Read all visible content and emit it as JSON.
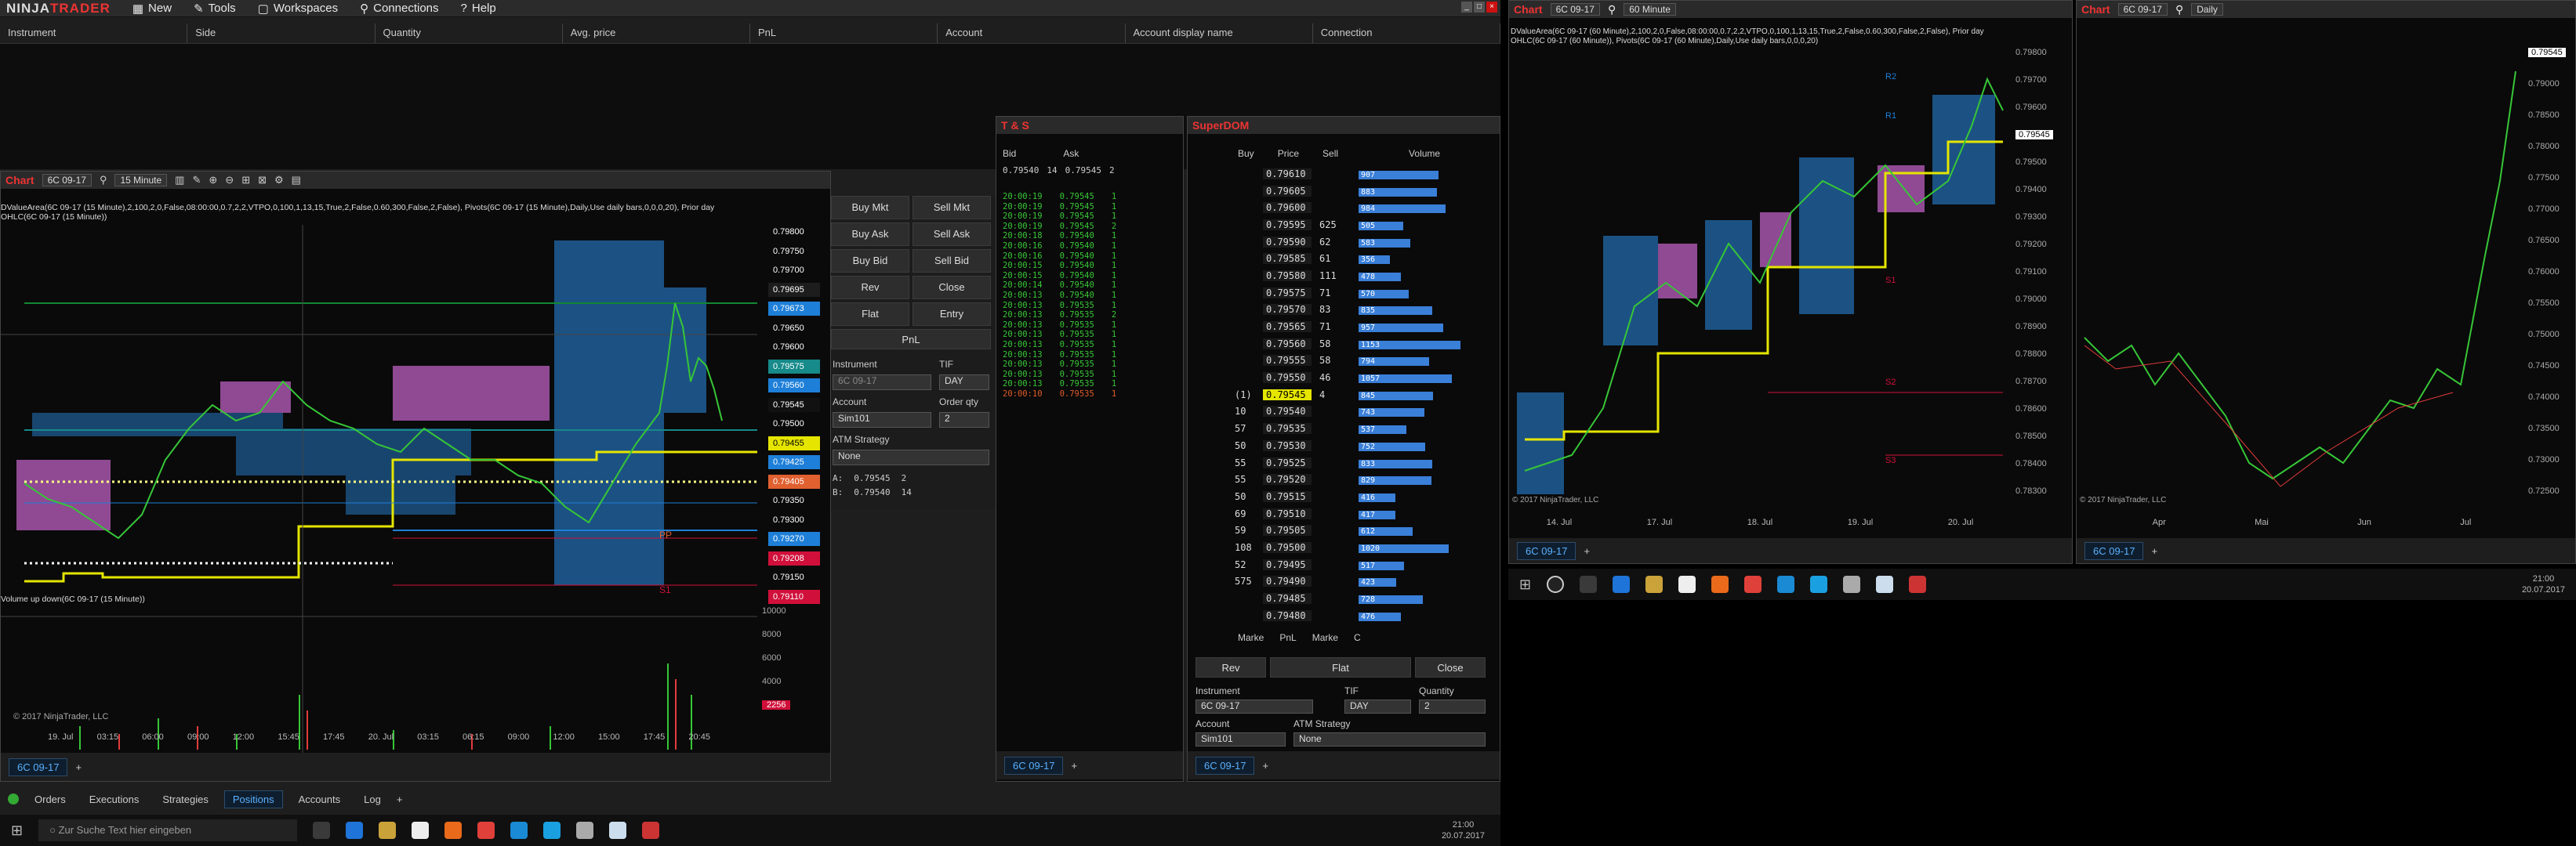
{
  "app": {
    "logo_a": "NINJA",
    "logo_b": "TRADER",
    "menu": [
      "New",
      "Tools",
      "Workspaces",
      "Connections",
      "Help"
    ]
  },
  "positions": {
    "columns": [
      "Instrument",
      "Side",
      "Quantity",
      "Avg. price",
      "PnL",
      "Account",
      "Account display name",
      "Connection"
    ]
  },
  "chart1": {
    "title": "Chart",
    "instrument": "6C 09-17",
    "interval": "15 Minute",
    "indicator_line1": "DValueArea(6C 09-17 (15 Minute),2,100,2,0,False,08:00:00,0.7,2,2,VTPO,0,100,1,13,15,True,2,False,0.60,300,False,2,False), Pivots(6C 09-17 (15 Minute),Daily,Use daily bars,0,0,0,20), Prior day",
    "indicator_line2": "OHLC(6C 09-17 (15 Minute))",
    "volume_label": "Volume up down(6C 09-17 (15 Minute))",
    "copyright": "© 2017 NinjaTrader, LLC",
    "price_labels": [
      {
        "v": "0.79800",
        "c": "#0a0a0a"
      },
      {
        "v": "0.79750",
        "c": "#0a0a0a"
      },
      {
        "v": "0.79700",
        "c": "#0a0a0a"
      },
      {
        "v": "0.79695",
        "c": "#1d1d1d"
      },
      {
        "v": "0.79673",
        "c": "#1e7fd8"
      },
      {
        "v": "0.79650",
        "c": "#0a0a0a"
      },
      {
        "v": "0.79600",
        "c": "#0a0a0a"
      },
      {
        "v": "0.79575",
        "c": "#178a8a"
      },
      {
        "v": "0.79560",
        "c": "#1e7fd8"
      },
      {
        "v": "0.79545",
        "c": "#111"
      },
      {
        "v": "0.79500",
        "c": "#0a0a0a"
      },
      {
        "v": "0.79455",
        "c": "#e5e500"
      },
      {
        "v": "0.79425",
        "c": "#1e7fd8"
      },
      {
        "v": "0.79405",
        "c": "#e06030"
      },
      {
        "v": "0.79350",
        "c": "#0a0a0a"
      },
      {
        "v": "0.79300",
        "c": "#0a0a0a"
      },
      {
        "v": "0.79270",
        "c": "#1e7fd8"
      },
      {
        "v": "0.79208",
        "c": "#d0103a"
      },
      {
        "v": "0.79150",
        "c": "#0a0a0a"
      },
      {
        "v": "0.79110",
        "c": "#d0103a"
      }
    ],
    "vol_axis": [
      "10000",
      "8000",
      "6000",
      "4000",
      "2256"
    ],
    "time_axis": [
      "19. Jul",
      "03:15",
      "06:00",
      "09:00",
      "12:00",
      "15:45",
      "17:45",
      "20. Jul",
      "03:15",
      "06:15",
      "09:00",
      "12:00",
      "15:00",
      "17:45",
      "20:45"
    ],
    "pivot_labels": [
      "PP",
      "S1"
    ],
    "tab": "6C 09-17"
  },
  "order_panel": {
    "buttons": [
      "Buy Mkt",
      "Sell Mkt",
      "Buy Ask",
      "Sell Ask",
      "Buy Bid",
      "Sell Bid",
      "Rev",
      "Close",
      "Flat",
      "Entry",
      "PnL"
    ],
    "instrument_label": "Instrument",
    "tif_label": "TIF",
    "instrument": "6C 09-17",
    "tif": "DAY",
    "account_label": "Account",
    "qty_label": "Order qty",
    "account": "Sim101",
    "qty": "2",
    "atm_label": "ATM Strategy",
    "atm": "None",
    "a_label": "A:",
    "a_price": "0.79545",
    "a_qty": "2",
    "b_label": "B:",
    "b_price": "0.79540",
    "b_qty": "14"
  },
  "ts": {
    "title": "T & S",
    "bid_header": "Bid",
    "ask_header": "Ask",
    "bid": "0.79540",
    "bid_size": "14",
    "ask": "0.79545",
    "ask_size": "2",
    "rows": [
      [
        "20:00:19",
        "0.79545",
        "1",
        "g"
      ],
      [
        "20:00:19",
        "0.79545",
        "1",
        "g"
      ],
      [
        "20:00:19",
        "0.79545",
        "1",
        "g"
      ],
      [
        "20:00:19",
        "0.79545",
        "2",
        "g"
      ],
      [
        "20:00:18",
        "0.79540",
        "1",
        "g"
      ],
      [
        "20:00:16",
        "0.79540",
        "1",
        "g"
      ],
      [
        "20:00:16",
        "0.79540",
        "1",
        "g"
      ],
      [
        "20:00:15",
        "0.79540",
        "1",
        "g"
      ],
      [
        "20:00:15",
        "0.79540",
        "1",
        "g"
      ],
      [
        "20:00:14",
        "0.79540",
        "1",
        "g"
      ],
      [
        "20:00:13",
        "0.79540",
        "1",
        "g"
      ],
      [
        "20:00:13",
        "0.79535",
        "1",
        "g"
      ],
      [
        "20:00:13",
        "0.79535",
        "2",
        "g"
      ],
      [
        "20:00:13",
        "0.79535",
        "1",
        "g"
      ],
      [
        "20:00:13",
        "0.79535",
        "1",
        "g"
      ],
      [
        "20:00:13",
        "0.79535",
        "1",
        "g"
      ],
      [
        "20:00:13",
        "0.79535",
        "1",
        "g"
      ],
      [
        "20:00:13",
        "0.79535",
        "1",
        "g"
      ],
      [
        "20:00:13",
        "0.79535",
        "1",
        "g"
      ],
      [
        "20:00:13",
        "0.79535",
        "1",
        "g"
      ],
      [
        "20:00:10",
        "0.79535",
        "1",
        "r"
      ]
    ],
    "tab": "6C 09-17"
  },
  "dom": {
    "title": "SuperDOM",
    "headers": [
      "Buy",
      "Price",
      "Sell",
      "Volume"
    ],
    "rows": [
      [
        "",
        "0.79610",
        "",
        "907"
      ],
      [
        "",
        "0.79605",
        "",
        "883"
      ],
      [
        "",
        "0.79600",
        "",
        "984"
      ],
      [
        "",
        "0.79595",
        "625",
        "505"
      ],
      [
        "",
        "0.79590",
        "62",
        "583"
      ],
      [
        "",
        "0.79585",
        "61",
        "356"
      ],
      [
        "",
        "0.79580",
        "111",
        "478"
      ],
      [
        "",
        "0.79575",
        "71",
        "570"
      ],
      [
        "",
        "0.79570",
        "83",
        "835"
      ],
      [
        "",
        "0.79565",
        "71",
        "957"
      ],
      [
        "",
        "0.79560",
        "58",
        "1153"
      ],
      [
        "",
        "0.79555",
        "58",
        "794"
      ],
      [
        "",
        "0.79550",
        "46",
        "1057"
      ],
      [
        "(1)",
        "0.79545",
        "4",
        "845"
      ],
      [
        "10",
        "0.79540",
        "",
        "743"
      ],
      [
        "57",
        "0.79535",
        "",
        "537"
      ],
      [
        "50",
        "0.79530",
        "",
        "752"
      ],
      [
        "55",
        "0.79525",
        "",
        "833"
      ],
      [
        "55",
        "0.79520",
        "",
        "829"
      ],
      [
        "50",
        "0.79515",
        "",
        "416"
      ],
      [
        "69",
        "0.79510",
        "",
        "417"
      ],
      [
        "59",
        "0.79505",
        "",
        "612"
      ],
      [
        "108",
        "0.79500",
        "",
        "1020"
      ],
      [
        "52",
        "0.79495",
        "",
        "517"
      ],
      [
        "575",
        "0.79490",
        "",
        "423"
      ],
      [
        "",
        "0.79485",
        "",
        "728"
      ],
      [
        "",
        "0.79480",
        "",
        "476"
      ]
    ],
    "bottom": [
      "Marke",
      "PnL",
      "Marke",
      "C"
    ],
    "buttons": [
      "Rev",
      "Flat",
      "Close"
    ],
    "instrument_label": "Instrument",
    "tif_label": "TIF",
    "qty_label": "Quantity",
    "instrument": "6C 09-17",
    "tif": "DAY",
    "qty": "2",
    "account_label": "Account",
    "atm_label": "ATM Strategy",
    "account": "Sim101",
    "atm": "None",
    "tab": "6C 09-17"
  },
  "chart2": {
    "title": "Chart",
    "instrument": "6C 09-17",
    "interval": "60 Minute",
    "indicator_line1": "DValueArea(6C 09-17 (60 Minute),2,100,2,0,False,08:00:00,0.7,2,2,VTPO,0,100,1,13,15,True,2,False,0.60,300,False,2,False), Prior day",
    "indicator_line2": "OHLC(6C 09-17 (60 Minute)), Pivots(6C 09-17 (60 Minute),Daily,Use daily bars,0,0,0,20)",
    "copyright": "© 2017 NinjaTrader, LLC",
    "price_axis": [
      "0.79800",
      "0.79700",
      "0.79600",
      "0.79545",
      "0.79500",
      "0.79400",
      "0.79300",
      "0.79200",
      "0.79100",
      "0.79000",
      "0.78900",
      "0.78800",
      "0.78700",
      "0.78600",
      "0.78500",
      "0.78400",
      "0.78300"
    ],
    "time_axis": [
      "14. Jul",
      "17. Jul",
      "18. Jul",
      "19. Jul",
      "20. Jul"
    ],
    "pivots": [
      "R2",
      "R1",
      "S1",
      "S2",
      "S3"
    ],
    "tab": "6C 09-17"
  },
  "chart3": {
    "title": "Chart",
    "instrument": "6C 09-17",
    "interval": "Daily",
    "copyright": "© 2017 NinjaTrader, LLC",
    "price_axis": [
      "0.79545",
      "0.79000",
      "0.78500",
      "0.78000",
      "0.77500",
      "0.77000",
      "0.76500",
      "0.76000",
      "0.75500",
      "0.75000",
      "0.74500",
      "0.74000",
      "0.73500",
      "0.73000",
      "0.72500"
    ],
    "time_axis": [
      "Apr",
      "Mai",
      "Jun",
      "Jul"
    ],
    "tab": "6C 09-17"
  },
  "bottom_tabs": [
    "Orders",
    "Executions",
    "Strategies",
    "Positions",
    "Accounts",
    "Log"
  ],
  "taskbar_left": {
    "search": "Zur Suche Text hier eingeben",
    "time": "21:00",
    "date": "20.07.2017"
  },
  "taskbar_right": {
    "time": "21:00",
    "date": "20.07.2017"
  }
}
